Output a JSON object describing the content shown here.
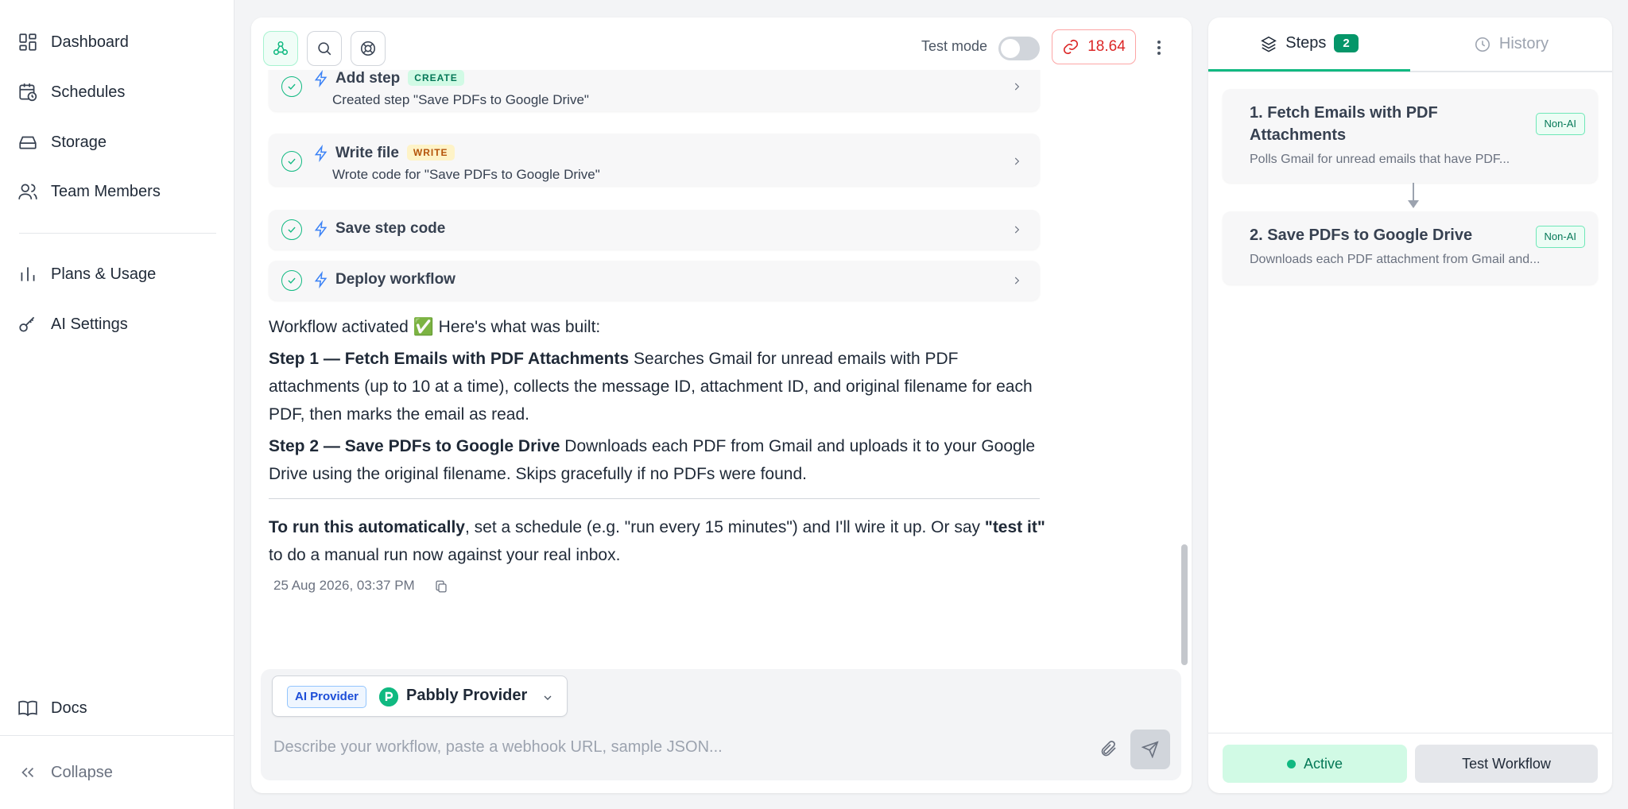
{
  "sidebar": {
    "items": [
      {
        "label": "Dashboard",
        "icon": "dashboard-icon"
      },
      {
        "label": "Schedules",
        "icon": "calendar-clock-icon"
      },
      {
        "label": "Storage",
        "icon": "storage-icon"
      },
      {
        "label": "Team Members",
        "icon": "team-icon"
      },
      {
        "label": "Plans & Usage",
        "icon": "bar-chart-icon"
      },
      {
        "label": "AI Settings",
        "icon": "key-icon"
      }
    ],
    "docs_label": "Docs",
    "collapse_label": "Collapse"
  },
  "toolbar": {
    "test_mode_label": "Test mode",
    "test_mode_on": false,
    "credits_value": "18.64"
  },
  "chat": {
    "steps": [
      {
        "title": "Add step",
        "badge": "CREATE",
        "subtitle": "Created step \"Save PDFs to Google Drive\""
      },
      {
        "title": "Write file",
        "badge": "WRITE",
        "subtitle": "Wrote code for \"Save PDFs to Google Drive\""
      },
      {
        "title": "Save step code"
      },
      {
        "title": "Deploy workflow"
      }
    ],
    "message": {
      "intro": "Workflow activated ✅ Here's what was built:",
      "step1_title": "Step 1 — Fetch Emails with PDF Attachments",
      "step1_text": " Searches Gmail for unread emails with PDF attachments (up to 10 at a time), collects the message ID, attachment ID, and original filename for each PDF, then marks the email as read.",
      "step2_title": "Step 2 — Save PDFs to Google Drive",
      "step2_text": " Downloads each PDF from Gmail and uploads it to your Google Drive using the original filename. Skips gracefully if no PDFs were found.",
      "outro_bold": "To run this automatically",
      "outro_text1": ", set a schedule (e.g. \"run every 15 minutes\") and I'll wire it up. Or say ",
      "outro_bold2": "\"test it\"",
      "outro_text2": " to do a manual run now against your real inbox."
    },
    "timestamp": "25 Aug 2026, 03:37 PM"
  },
  "composer": {
    "ai_provider_badge": "AI Provider",
    "provider_name": "Pabbly Provider",
    "placeholder": "Describe your workflow, paste a webhook URL, sample JSON..."
  },
  "panel": {
    "tabs": {
      "steps": "Steps",
      "steps_count": "2",
      "history": "History"
    },
    "workflow_steps": [
      {
        "title_line1": "1. Fetch Emails with PDF",
        "title_line2": "Attachments",
        "badge": "Non-AI",
        "description": "Polls Gmail for unread emails that have PDF..."
      },
      {
        "title_line1": "2. Save PDFs to Google Drive",
        "badge": "Non-AI",
        "description": "Downloads each PDF attachment from Gmail and..."
      }
    ],
    "active_label": "Active",
    "test_workflow_label": "Test Workflow"
  },
  "colors": {
    "accent": "#10b981",
    "credits": "#dc2626",
    "link_blue": "#3b82f6"
  }
}
